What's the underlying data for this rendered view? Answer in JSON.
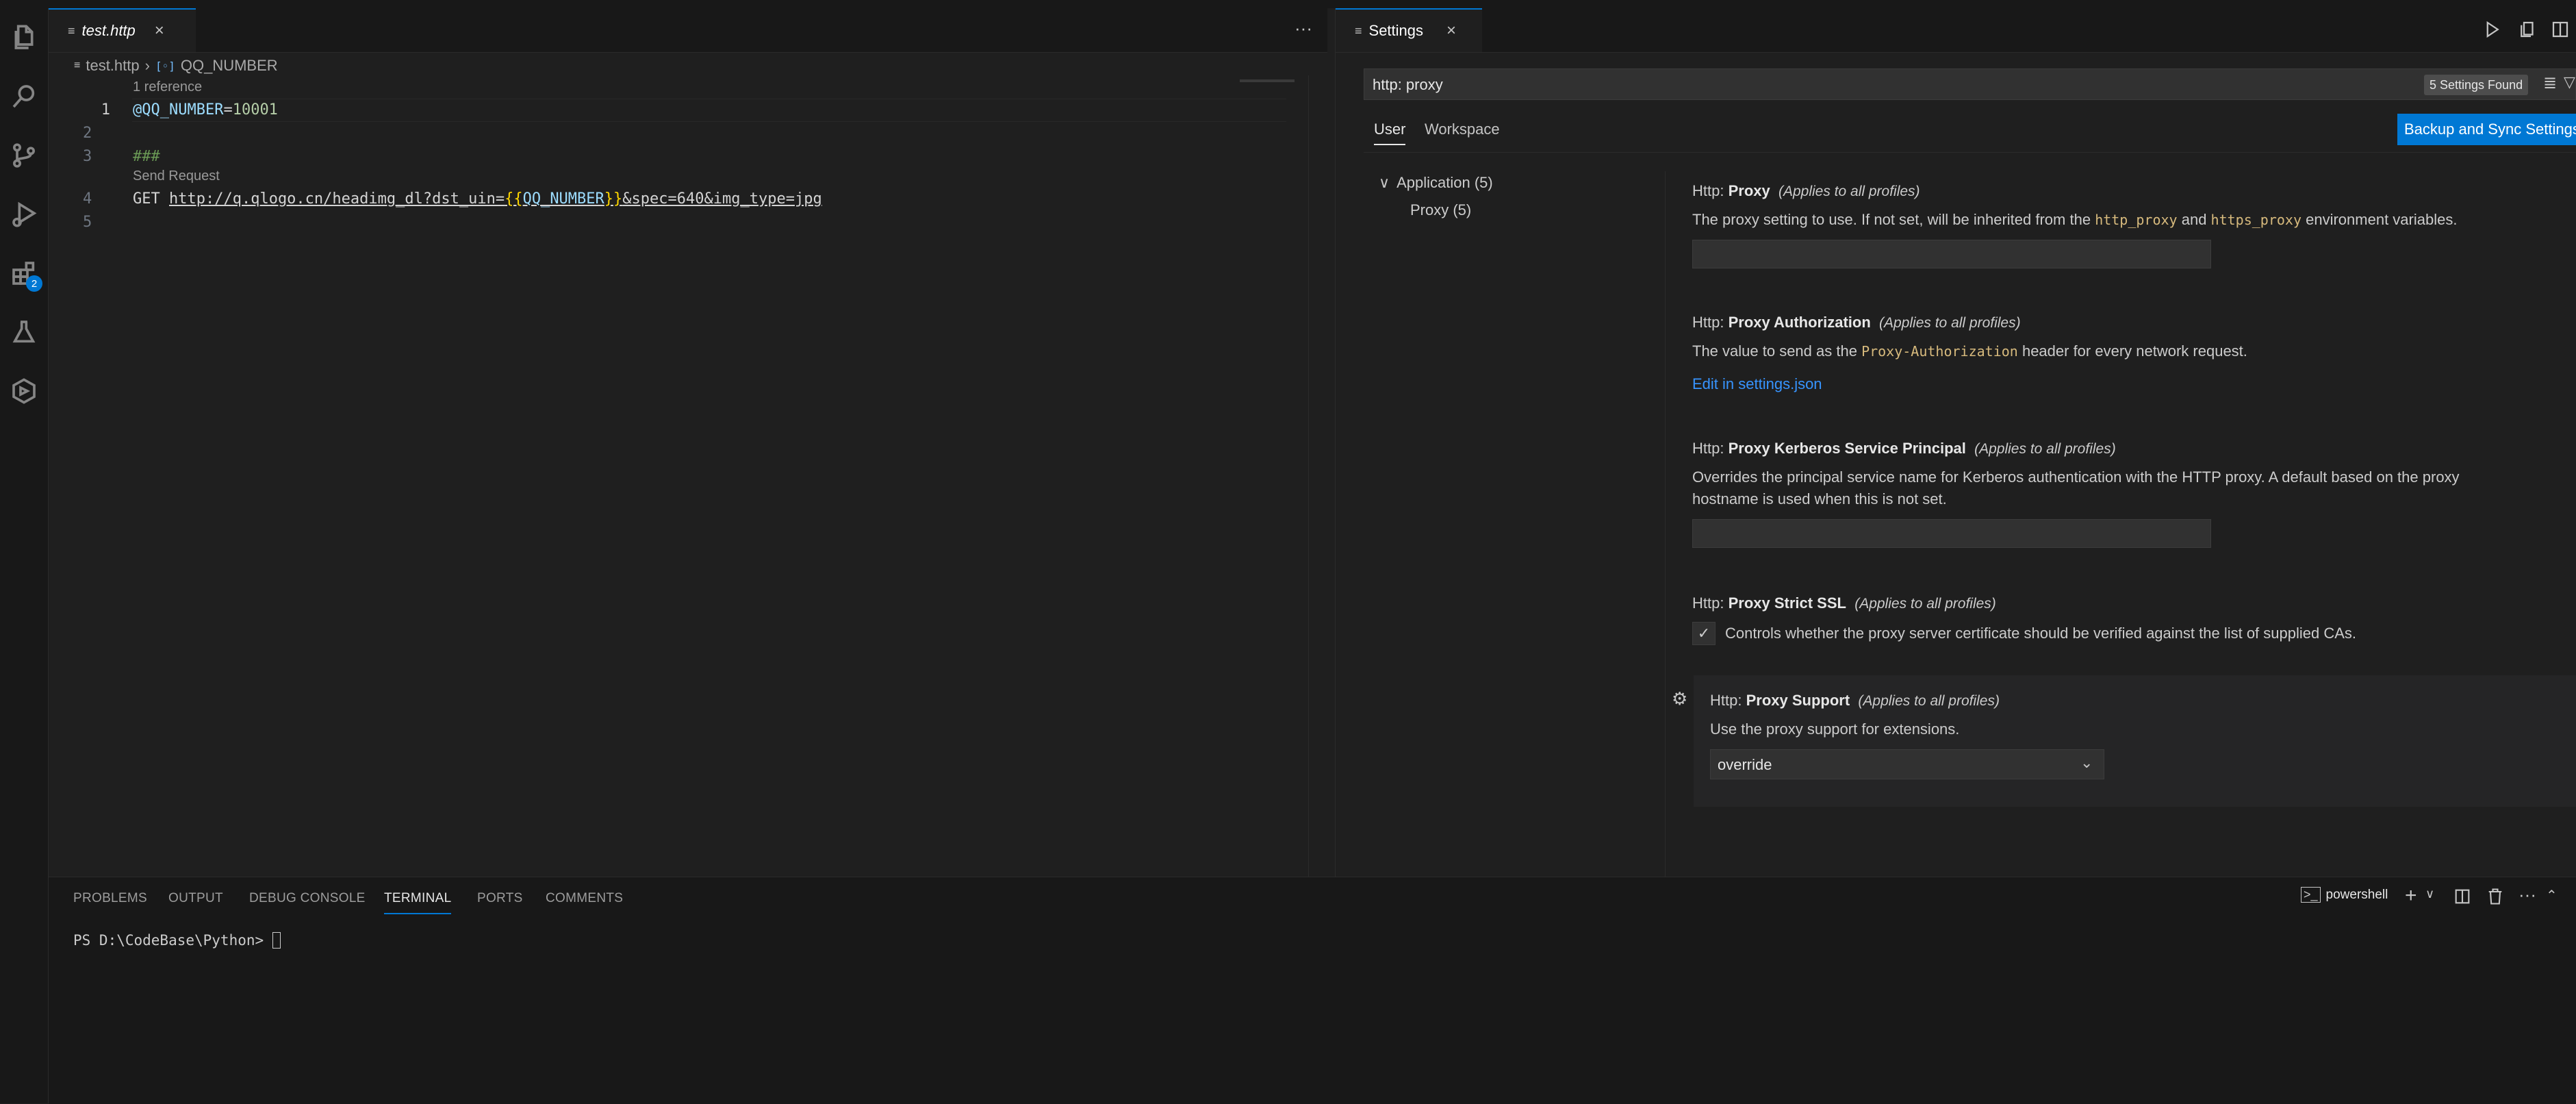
{
  "activity_bar": {
    "items": [
      {
        "name": "explorer-icon"
      },
      {
        "name": "search-icon"
      },
      {
        "name": "source-control-icon"
      },
      {
        "name": "run-debug-icon"
      },
      {
        "name": "extensions-icon",
        "badge": "2"
      },
      {
        "name": "testing-icon"
      },
      {
        "name": "remote-icon"
      }
    ]
  },
  "left_editor": {
    "tab": {
      "label": "test.http",
      "close": "×"
    },
    "more": "···",
    "breadcrumb": {
      "file": "test.http",
      "separator": "›",
      "symbol": "QQ_NUMBER"
    },
    "codelens_reference": "1 reference",
    "codelens_send": "Send Request",
    "lines": [
      {
        "no": "1",
        "var": "@QQ_NUMBER",
        "eq": "=",
        "val": "10001"
      },
      {
        "no": "2"
      },
      {
        "no": "3",
        "comment": "###"
      },
      {
        "no": "4",
        "method": "GET",
        "url_pre": "http://q.qlogo.cn/headimg_dl?dst_uin=",
        "brace_open": "{{",
        "tmpl": "QQ_NUMBER",
        "brace_close": "}}",
        "url_post": "&spec=640&img_type=jpg"
      },
      {
        "no": "5"
      }
    ]
  },
  "settings": {
    "tab": {
      "label": "Settings",
      "close": "×"
    },
    "search_value": "http: proxy",
    "found_badge": "5 Settings Found",
    "scope_tabs": [
      "User",
      "Workspace"
    ],
    "sync_button": "Backup and Sync Settings",
    "toc": [
      {
        "label": "Application (5)"
      },
      {
        "label": "Proxy (5)"
      }
    ],
    "items": [
      {
        "prefix": "Http: ",
        "name": "Proxy",
        "scope": "(Applies to all profiles)",
        "desc_pre": "The proxy setting to use. If not set, will be inherited from the ",
        "code1": "http_proxy",
        "desc_mid": " and ",
        "code2": "https_proxy",
        "desc_post": " environment variables.",
        "input": ""
      },
      {
        "prefix": "Http: ",
        "name": "Proxy Authorization",
        "scope": "(Applies to all profiles)",
        "desc_pre": "The value to send as the ",
        "code1": "Proxy-Authorization",
        "desc_post": " header for every network request.",
        "link": "Edit in settings.json"
      },
      {
        "prefix": "Http: ",
        "name": "Proxy Kerberos Service Principal",
        "scope": "(Applies to all profiles)",
        "desc_line1": "Overrides the principal service name for Kerberos authentication with the HTTP proxy. A default based on the proxy",
        "desc_line2": "hostname is used when this is not set.",
        "input": ""
      },
      {
        "prefix": "Http: ",
        "name": "Proxy Strict SSL",
        "scope": "(Applies to all profiles)",
        "checkbox_label": "Controls whether the proxy server certificate should be verified against the list of supplied CAs.",
        "checked": true
      },
      {
        "prefix": "Http: ",
        "name": "Proxy Support",
        "scope": "(Applies to all profiles)",
        "desc": "Use the proxy support for extensions.",
        "select": "override"
      }
    ]
  },
  "panel": {
    "tabs": [
      "PROBLEMS",
      "OUTPUT",
      "DEBUG CONSOLE",
      "TERMINAL",
      "PORTS",
      "COMMENTS"
    ],
    "active_tab": "TERMINAL",
    "shell_label": "powershell",
    "prompt": "PS D:\\CodeBase\\Python> "
  },
  "colors": {
    "accent": "#0078d4",
    "keyword_var": "#9cdcfe",
    "number": "#b5cea8",
    "comment": "#6a9955",
    "brace": "#ffd700",
    "link": "#3794ff"
  }
}
